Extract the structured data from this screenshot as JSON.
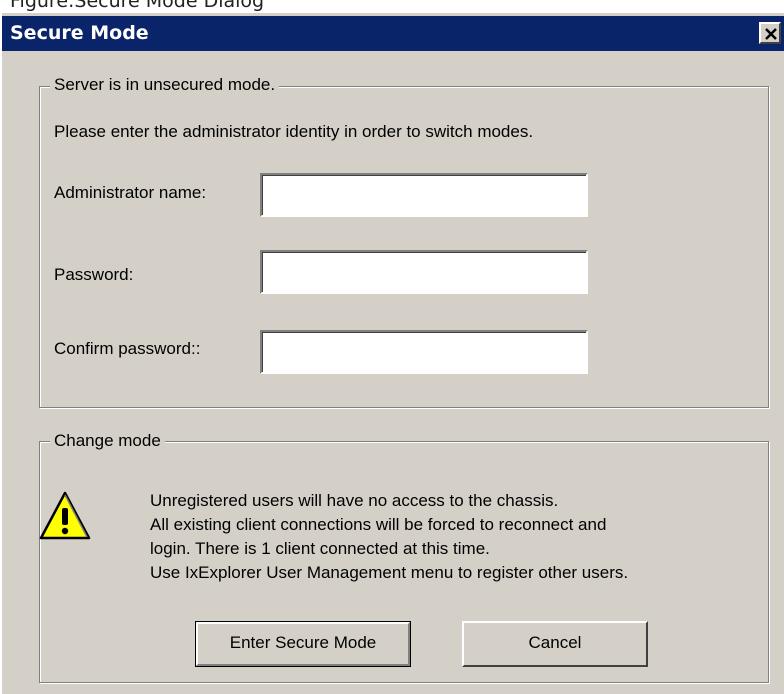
{
  "figure_caption": "Figure:Secure Mode Dialog",
  "window": {
    "title": "Secure Mode",
    "close_glyph": "✕"
  },
  "identity_group": {
    "legend": "Server is in unsecured mode.",
    "instruction": "Please enter the administrator identity in order to switch modes.",
    "fields": [
      {
        "label": "Administrator name:",
        "value": ""
      },
      {
        "label": "Password:",
        "value": ""
      },
      {
        "label": "Confirm password::",
        "value": ""
      }
    ]
  },
  "change_group": {
    "legend": "Change mode",
    "icon": "warning-icon",
    "message_lines": [
      "Unregistered users will have no access to the chassis.",
      "All existing client connections will be forced to reconnect and",
      "login. There is 1 client connected at this time.",
      "Use IxExplorer User Management menu to register other users."
    ]
  },
  "buttons": {
    "enter_secure_mode": "Enter Secure Mode",
    "cancel": "Cancel"
  },
  "colors": {
    "titlebar": "#0a246a",
    "dialog_face": "#d4d0c8",
    "warning_fill": "#ffff00"
  }
}
